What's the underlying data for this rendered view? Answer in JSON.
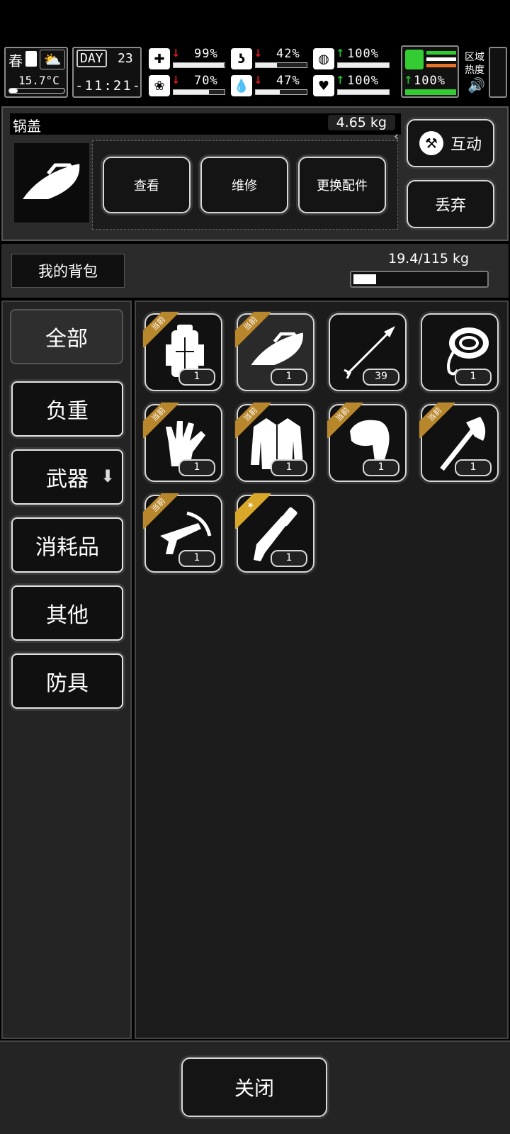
{
  "hud": {
    "season": "春",
    "temperature": "15.7°C",
    "day_label": "DAY",
    "day_number": "23",
    "time": "-11:21-",
    "stats": [
      {
        "name": "health",
        "value": "99%",
        "trend": "down",
        "fill": 0.99
      },
      {
        "name": "hunger",
        "value": "42%",
        "trend": "down",
        "fill": 0.42
      },
      {
        "name": "stamina",
        "value": "100%",
        "trend": "up",
        "fill": 1.0
      },
      {
        "name": "sanity",
        "value": "70%",
        "trend": "down",
        "fill": 0.7
      },
      {
        "name": "thirst",
        "value": "47%",
        "trend": "down",
        "fill": 0.47
      },
      {
        "name": "mood",
        "value": "100%",
        "trend": "up",
        "fill": 1.0
      }
    ],
    "energy_value": "100%",
    "zone_heat_label": "区域热度"
  },
  "selected_item": {
    "name": "锅盖",
    "weight": "4.65 kg",
    "actions": [
      "查看",
      "维修",
      "更换配件"
    ],
    "interact_label": "互动",
    "discard_label": "丢弃"
  },
  "backpack": {
    "title": "我的背包",
    "capacity": "19.4/115 kg",
    "capacity_fill": 0.17
  },
  "categories": [
    {
      "label": "全部",
      "active": true
    },
    {
      "label": "负重",
      "active": false
    },
    {
      "label": "武器",
      "active": false,
      "has_arrow": true
    },
    {
      "label": "消耗品",
      "active": false
    },
    {
      "label": "其他",
      "active": false
    },
    {
      "label": "防具",
      "active": false
    }
  ],
  "items": [
    {
      "icon": "backpack-icon",
      "count": "1",
      "badge": "当前"
    },
    {
      "icon": "pot-lid-icon",
      "count": "1",
      "badge": "当前",
      "selected": true
    },
    {
      "icon": "arrow-icon",
      "count": "39",
      "badge": ""
    },
    {
      "icon": "rope-icon",
      "count": "1",
      "badge": ""
    },
    {
      "icon": "glove-icon",
      "count": "1",
      "badge": "当前"
    },
    {
      "icon": "jacket-icon",
      "count": "1",
      "badge": "当前"
    },
    {
      "icon": "hood-icon",
      "count": "1",
      "badge": "当前"
    },
    {
      "icon": "axe-icon",
      "count": "1",
      "badge": "当前"
    },
    {
      "icon": "crossbow-icon",
      "count": "1",
      "badge": "当前"
    },
    {
      "icon": "machete-icon",
      "count": "1",
      "badge": "★"
    }
  ],
  "close_label": "关闭",
  "colors": {
    "ribbon": "#b8862b",
    "stat_down": "#e01b1b",
    "stat_up": "#22c02a",
    "energy_green": "#33cc33",
    "energy_orange": "#e8722a"
  }
}
